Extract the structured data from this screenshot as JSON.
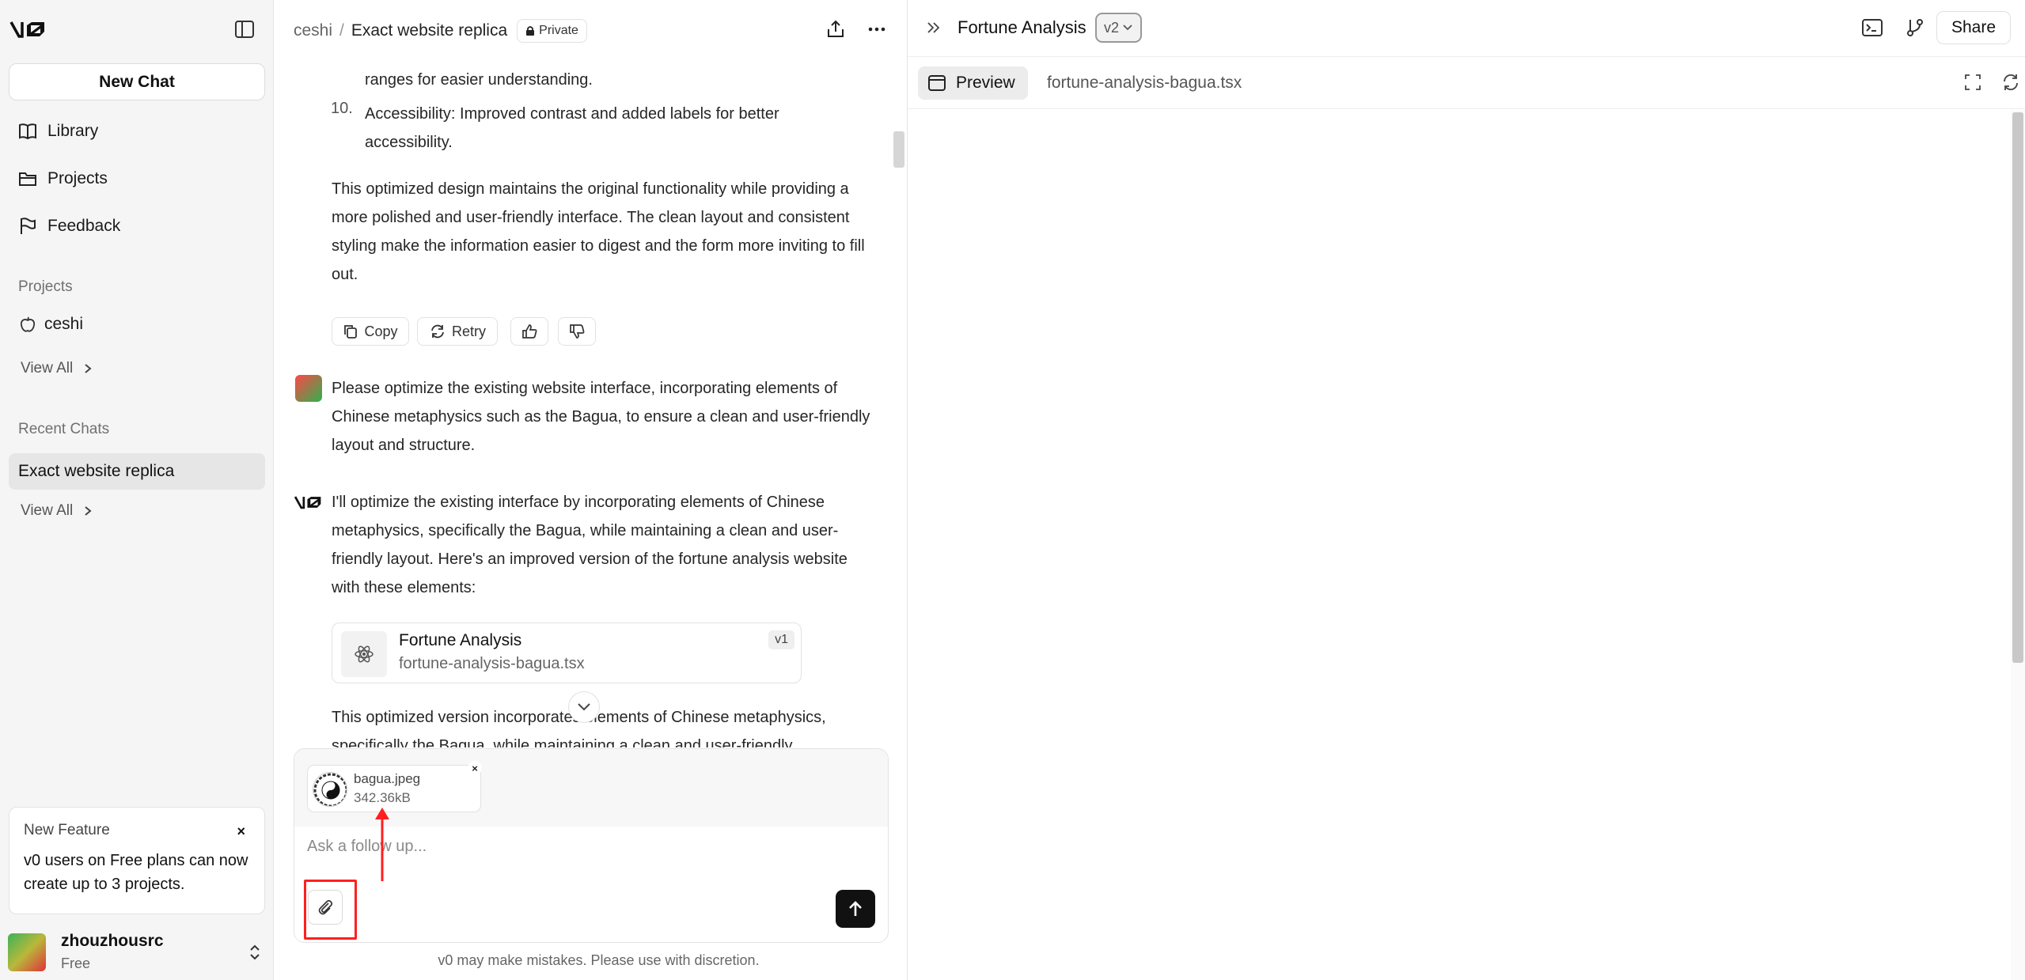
{
  "sidebar": {
    "new_chat": "New Chat",
    "nav": [
      {
        "label": "Library",
        "icon": "book-icon"
      },
      {
        "label": "Projects",
        "icon": "folder-icon"
      },
      {
        "label": "Feedback",
        "icon": "flag-icon"
      }
    ],
    "projects_heading": "Projects",
    "project_item": "ceshi",
    "view_all_projects": "View All",
    "recent_heading": "Recent Chats",
    "recent_item": "Exact website replica",
    "view_all_recent": "View All",
    "feature": {
      "title": "New Feature",
      "close": "×",
      "body": "v0 users on Free plans can now create up to 3 projects."
    },
    "user": {
      "name": "zhouzhousrc",
      "plan": "Free"
    }
  },
  "chat": {
    "breadcrumb": {
      "project": "ceshi",
      "separator": "/",
      "chat": "Exact website replica",
      "visibility": "Private"
    },
    "list_tail": "ranges for easier understanding.",
    "item10_num": "10.",
    "item10_text": "Accessibility: Improved contrast and added labels for better accessibility.",
    "summary": "This optimized design maintains the original functionality while providing a more polished and user-friendly interface. The clean layout and consistent styling make the information easier to digest and the form more inviting to fill out.",
    "actions": {
      "copy": "Copy",
      "retry": "Retry"
    },
    "user_message": "Please optimize the existing website interface, incorporating elements of Chinese metaphysics such as the Bagua, to ensure a clean and user-friendly layout and structure.",
    "assistant_message": "I'll optimize the existing interface by incorporating elements of Chinese metaphysics, specifically the Bagua, while maintaining a clean and user-friendly layout. Here's an improved version of the fortune analysis website with these elements:",
    "artifact": {
      "title": "Fortune Analysis",
      "file": "fortune-analysis-bagua.tsx",
      "version": "v1"
    },
    "trailing_text": "This optimized version incorporates elements of Chinese metaphysics, specifically the Bagua, while maintaining a clean and user-friendly",
    "composer": {
      "attachment": {
        "name": "bagua.jpeg",
        "size": "342.36kB",
        "remove": "×"
      },
      "placeholder": "Ask a follow up..."
    },
    "disclaimer": "v0 may make mistakes. Please use with discretion."
  },
  "preview": {
    "title": "Fortune Analysis",
    "version": "v2",
    "share": "Share",
    "tab_preview": "Preview",
    "tab_file": "fortune-analysis-bagua.tsx"
  },
  "colors": {
    "highlight_red": "#ff1f1f",
    "send_button": "#111111",
    "sidebar_bg": "#f5f5f5"
  }
}
